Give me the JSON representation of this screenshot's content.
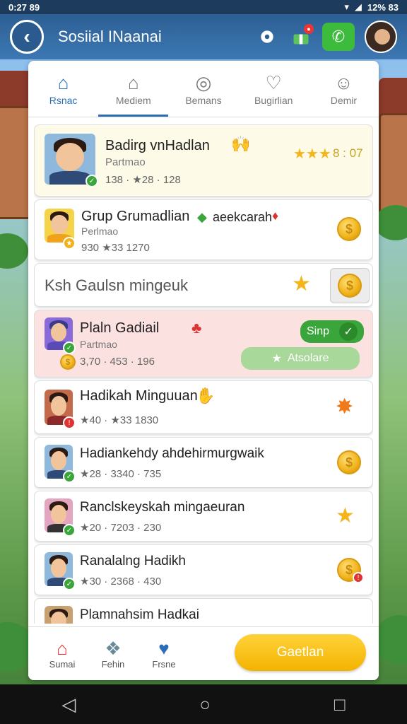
{
  "status": {
    "time": "0:27 89",
    "right": "12% 83"
  },
  "header": {
    "title": "Sosiial INaanai",
    "back": "‹"
  },
  "tabs": [
    {
      "label": "Rsnac",
      "icon": "home-icon"
    },
    {
      "label": "Mediem",
      "icon": "house-outline-icon"
    },
    {
      "label": "Bemans",
      "icon": "search-person-icon"
    },
    {
      "label": "Bugirlian",
      "icon": "shield-heart-icon"
    },
    {
      "label": "Demir",
      "icon": "person-icon"
    }
  ],
  "rows": [
    {
      "name": "Badirg vnHadlan",
      "sub": "Partmao",
      "stats": "138 · ★28 · 128",
      "right": "8 : 07",
      "tag": "🙌"
    },
    {
      "name": "Grup Grumadlian",
      "name2": "aeekcarah",
      "sub": "Perlmao",
      "stats": "930 ★33 1270"
    },
    {
      "header": "Ksh Gaulsn mingeuk"
    },
    {
      "name": "Plaln Gadiail",
      "sub": "Partmao",
      "stats": "3,70 · 453 · 196",
      "ship": "Sinp",
      "action": "Atsolare"
    },
    {
      "name": "Hadikah Minguuan",
      "stats": "★40 · ★33 1830"
    },
    {
      "name": "Hadiankehdy ahdehirmurgwaik",
      "stats": "★28 · 3340 · 735"
    },
    {
      "name": "Ranclskeyskah mingaeuran",
      "stats": "★20 · 7203 · 230"
    },
    {
      "name": "Ranalalng Hadikh",
      "stats": "★30 · 2368 · 430"
    },
    {
      "name": "Plamnahsim Hadkai"
    }
  ],
  "bottom": {
    "home": "Sumai",
    "pets": "Fehin",
    "friends": "Frsne",
    "cta": "Gaetlan"
  },
  "colors": {
    "accent": "#2a6db7",
    "cta": "#f4b300",
    "green": "#3aa53a"
  }
}
